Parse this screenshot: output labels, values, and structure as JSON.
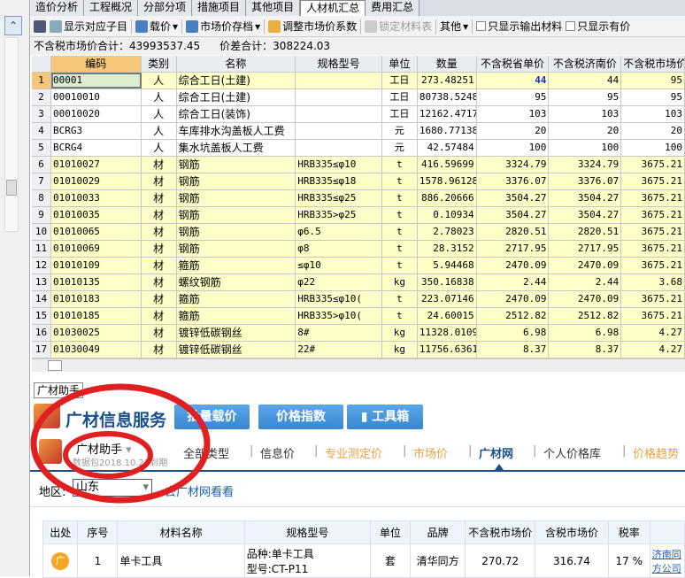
{
  "tabs": [
    "造价分析",
    "工程概况",
    "分部分项",
    "措施项目",
    "其他项目",
    "人材机汇总",
    "费用汇总"
  ],
  "active_tab": 5,
  "toolbar": {
    "show_sub": "显示对应子目",
    "load_price": "载价",
    "market_archive": "市场价存档",
    "adjust_coef": "调整市场价系数",
    "lock_table": "锁定材料表",
    "other": "其他",
    "only_output": "只显示输出材料",
    "only_price": "只显示有价"
  },
  "summary": {
    "market_total": "不含税市场价合计：43993537.45",
    "diff_total": "价差合计：308224.03"
  },
  "grid": {
    "headers": [
      "编码",
      "类别",
      "名称",
      "规格型号",
      "单位",
      "数量",
      "不含税省单价",
      "不含税济南价",
      "不含税市场价"
    ],
    "rows": [
      [
        "1",
        "00001",
        "人",
        "综合工日(土建)",
        "",
        "工日",
        "273.48251",
        "44",
        "44",
        "95"
      ],
      [
        "2",
        "00010010",
        "人",
        "综合工日(土建)",
        "",
        "工日",
        "80738.5248",
        "95",
        "95",
        "95"
      ],
      [
        "3",
        "00010020",
        "人",
        "综合工日(装饰)",
        "",
        "工日",
        "12162.4717",
        "103",
        "103",
        "103"
      ],
      [
        "4",
        "BCRG3",
        "人",
        "车库排水沟盖板人工费",
        "",
        "元",
        "1680.77138",
        "20",
        "20",
        "20"
      ],
      [
        "5",
        "BCRG4",
        "人",
        "集水坑盖板人工费",
        "",
        "元",
        "42.57484",
        "100",
        "100",
        "100"
      ],
      [
        "6",
        "01010027",
        "材",
        "钢筋",
        "HRB335≤φ10",
        "t",
        "416.59699",
        "3324.79",
        "3324.79",
        "3675.21"
      ],
      [
        "7",
        "01010029",
        "材",
        "钢筋",
        "HRB335≤φ18",
        "t",
        "1578.96128",
        "3376.07",
        "3376.07",
        "3675.21"
      ],
      [
        "8",
        "01010033",
        "材",
        "钢筋",
        "HRB335≤φ25",
        "t",
        "886.20666",
        "3504.27",
        "3504.27",
        "3675.21"
      ],
      [
        "9",
        "01010035",
        "材",
        "钢筋",
        "HRB335>φ25",
        "t",
        "0.10934",
        "3504.27",
        "3504.27",
        "3675.21"
      ],
      [
        "10",
        "01010065",
        "材",
        "钢筋",
        "φ6.5",
        "t",
        "2.78023",
        "2820.51",
        "2820.51",
        "3675.21"
      ],
      [
        "11",
        "01010069",
        "材",
        "钢筋",
        "φ8",
        "t",
        "28.3152",
        "2717.95",
        "2717.95",
        "3675.21"
      ],
      [
        "12",
        "01010109",
        "材",
        "箍筋",
        "≤φ10",
        "t",
        "5.94468",
        "2470.09",
        "2470.09",
        "3675.21"
      ],
      [
        "13",
        "01010135",
        "材",
        "螺纹钢筋",
        "φ22",
        "kg",
        "350.16838",
        "2.44",
        "2.44",
        "3.68"
      ],
      [
        "14",
        "01010183",
        "材",
        "箍筋",
        "HRB335≤φ10(",
        "t",
        "223.07146",
        "2470.09",
        "2470.09",
        "3675.21"
      ],
      [
        "15",
        "01010185",
        "材",
        "箍筋",
        "HRB335>φ10(",
        "t",
        "24.60015",
        "2512.82",
        "2512.82",
        "3675.21"
      ],
      [
        "16",
        "01030025",
        "材",
        "镀锌低碳钢丝",
        "8#",
        "kg",
        "11328.0109",
        "6.98",
        "6.98",
        "4.27"
      ],
      [
        "17",
        "01030049",
        "材",
        "镀锌低碳钢丝",
        "22#",
        "kg",
        "11756.6361",
        "8.37",
        "8.37",
        "4.27"
      ]
    ]
  },
  "bottom_tab": "广材助手",
  "panel": {
    "title": "广材信息服务",
    "buttons": [
      "批量载价",
      "价格指数",
      "工具箱"
    ],
    "assistant": "广材助手",
    "package": "数据包2018.10.23到期",
    "nav": [
      {
        "label": "全部类型",
        "color": "#333"
      },
      {
        "label": "信息价",
        "color": "#333"
      },
      {
        "label": "专业测定价",
        "color": "#e8a040"
      },
      {
        "label": "市场价",
        "color": "#e8a040"
      },
      {
        "label": "广材网",
        "color": "#1a4f8c",
        "active": true
      },
      {
        "label": "个人价格库",
        "color": "#333"
      },
      {
        "label": "价格趋势",
        "color": "#e8a040"
      }
    ],
    "region_label": "地区:",
    "region_value": "山东",
    "region_link": "去广材网看看",
    "table": {
      "headers": [
        "出处",
        "序号",
        "材料名称",
        "规格型号",
        "单位",
        "品牌",
        "不含税市场价",
        "含税市场价",
        "税率",
        ""
      ],
      "rows": [
        {
          "source": "广",
          "no": "1",
          "name": "单卡工具",
          "spec1": "品种:单卡工具",
          "spec2": "型号:CT-P11",
          "unit": "套",
          "brand": "清华同方",
          "price": "270.72",
          "tax_price": "316.74",
          "rate": "17 %",
          "supplier": "济南同方公司"
        }
      ]
    }
  },
  "colors": {
    "accent": "#3a86d0",
    "highlight": "#ffffc8",
    "annotation": "#e02020"
  }
}
